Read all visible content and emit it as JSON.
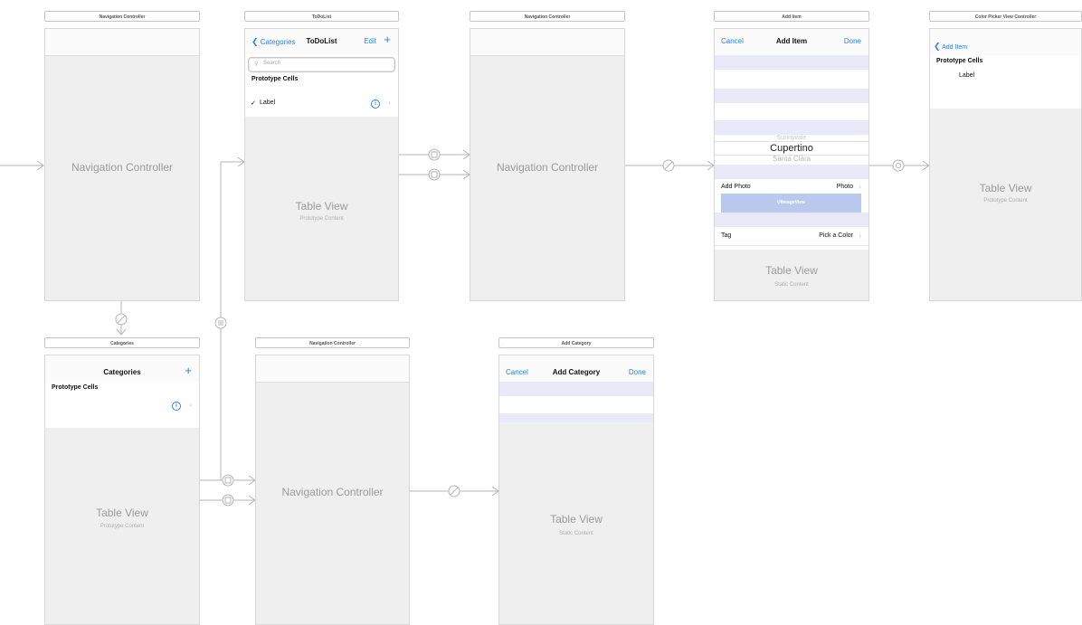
{
  "scenes": {
    "nav1": {
      "title": "Navigation Controller",
      "center": "Navigation Controller"
    },
    "todolist": {
      "title": "ToDoList",
      "back": "Categories",
      "nav_title": "ToDoList",
      "edit": "Edit",
      "add": "+",
      "search_placeholder": "Search",
      "section": "Prototype Cells",
      "cell_check": "✓",
      "cell_label": "Label",
      "table": "Table View",
      "table_sub": "Prototype Content"
    },
    "nav2": {
      "title": "Navigation Controller",
      "center": "Navigation Controller"
    },
    "additem": {
      "title": "Add Item",
      "cancel": "Cancel",
      "nav_title": "Add Item",
      "done": "Done",
      "picker_prev": "Sunnyvale",
      "picker_selected": "Cupertino",
      "picker_next": "Santa Clara",
      "add_photo": "Add Photo",
      "photo": "Photo",
      "imageview": "UIImageView",
      "tag": "Tag",
      "pick_color": "Pick a Color",
      "table": "Table View",
      "table_sub": "Static Content"
    },
    "colorpicker": {
      "title": "Color Picker View Controller",
      "back": "Add Item",
      "section": "Prototype Cells",
      "cell_label": "Label",
      "table": "Table View",
      "table_sub": "Prototype Content"
    },
    "categories": {
      "title": "Categories",
      "nav_title": "Categories",
      "add": "+",
      "section": "Prototype Cells",
      "table": "Table View",
      "table_sub": "Prototype Content"
    },
    "nav3": {
      "title": "Navigation Controller",
      "center": "Navigation Controller"
    },
    "addcategory": {
      "title": "Add Category",
      "cancel": "Cancel",
      "nav_title": "Add Category",
      "done": "Done",
      "table": "Table View",
      "table_sub": "Static Content"
    }
  },
  "icons": {
    "disclosure": "chevron-right-icon",
    "info": "info-icon",
    "back": "chevron-left-icon",
    "search": "search-icon",
    "add": "plus-icon"
  },
  "colors": {
    "accent": "#2f80ed",
    "canvas": "#efefef",
    "band": "#e9e9fa",
    "wire": "#b5b5b5"
  }
}
